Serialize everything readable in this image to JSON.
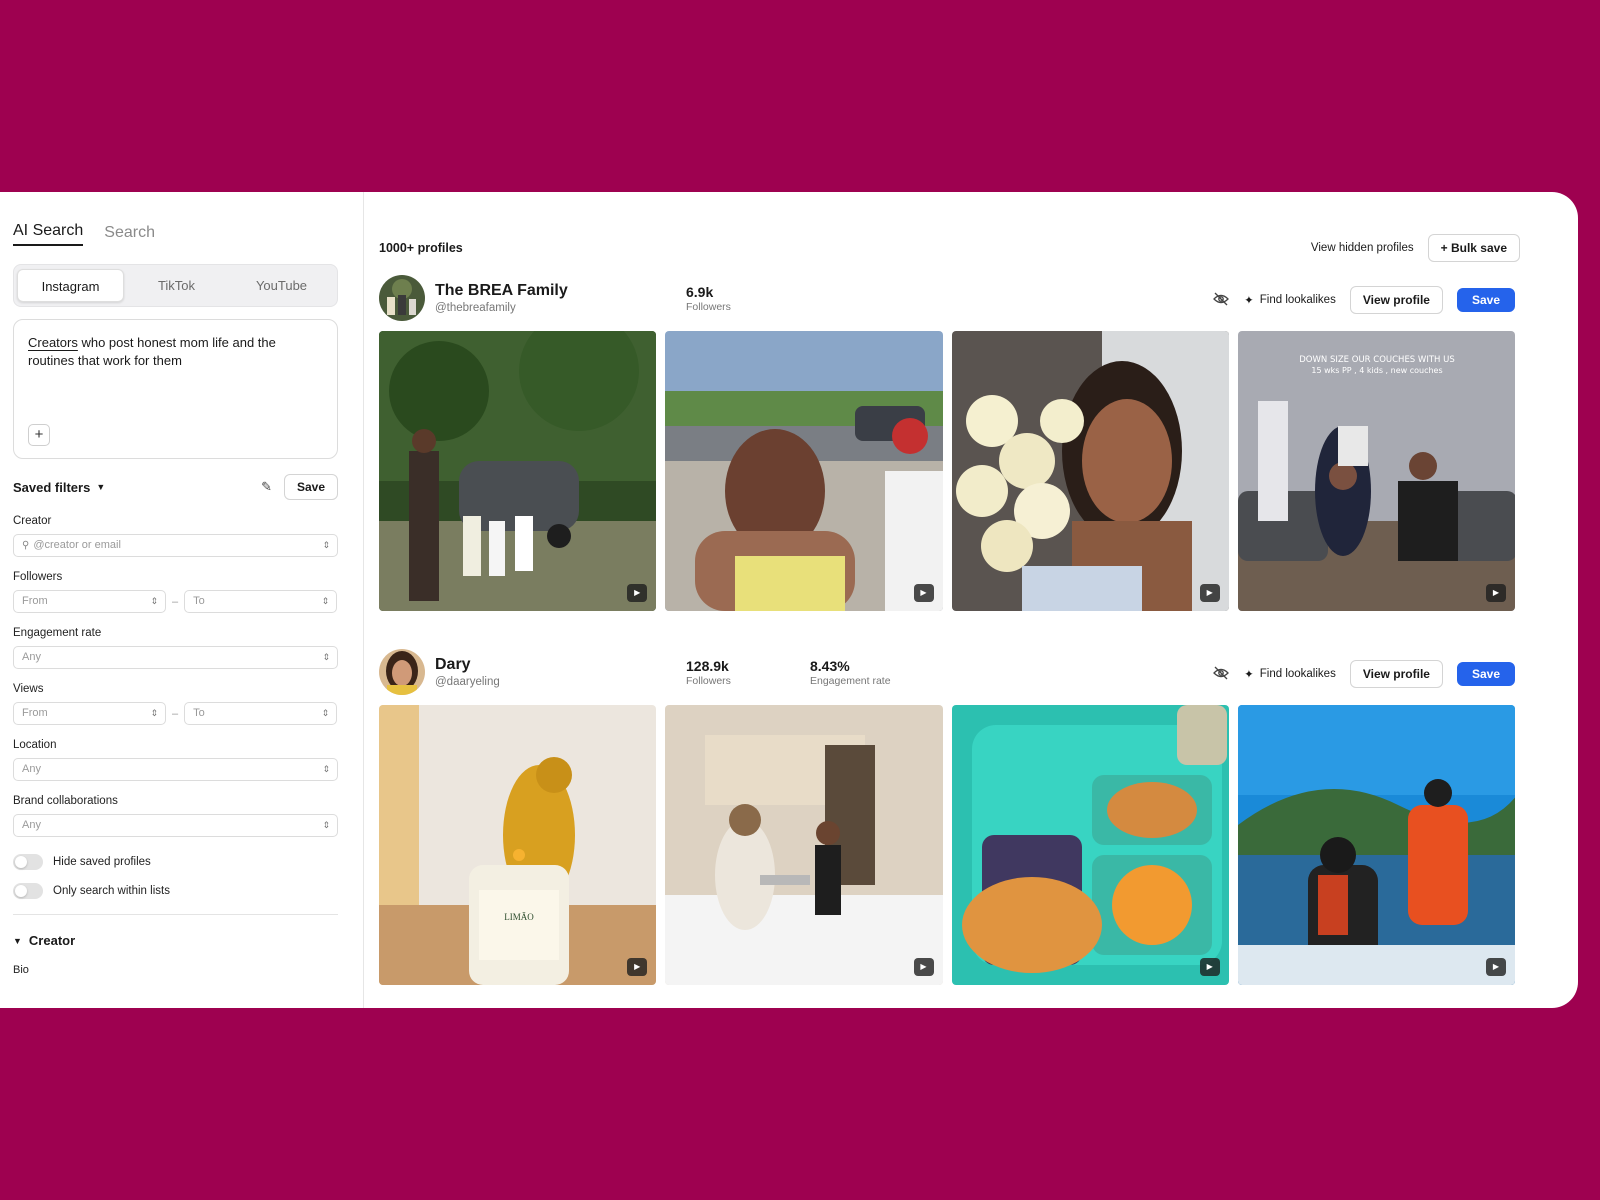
{
  "sidebar": {
    "tabs": [
      {
        "label": "AI Search"
      },
      {
        "label": "Search"
      }
    ],
    "platforms": [
      {
        "label": "Instagram"
      },
      {
        "label": "TikTok"
      },
      {
        "label": "YouTube"
      }
    ],
    "prompt": {
      "underlined_word": "Creators",
      "text": " who post honest mom life and the routines that work for them"
    },
    "saved_filters": {
      "label": "Saved filters",
      "save_label": "Save"
    },
    "creator": {
      "label": "Creator",
      "placeholder": "@creator or email"
    },
    "followers": {
      "label": "Followers",
      "from": "From",
      "to": "To"
    },
    "engagement": {
      "label": "Engagement rate",
      "value": "Any"
    },
    "views": {
      "label": "Views",
      "from": "From",
      "to": "To"
    },
    "location": {
      "label": "Location",
      "value": "Any"
    },
    "brand": {
      "label": "Brand collaborations",
      "value": "Any"
    },
    "toggles": [
      {
        "label": "Hide saved profiles"
      },
      {
        "label": "Only search within lists"
      }
    ],
    "section": {
      "label": "Creator"
    },
    "bio_label": "Bio"
  },
  "main": {
    "count": "1000+ profiles",
    "view_hidden": "View hidden profiles",
    "bulk_save": "+ Bulk save",
    "profiles": [
      {
        "name": "The BREA Family",
        "handle": "@thebreafamily",
        "followers_value": "6.9k",
        "followers_label": "Followers",
        "find_lookalikes": "Find lookalikes",
        "view_profile": "View profile",
        "save": "Save",
        "overlay_text": [
          "DOWN SIZE OUR COUCHES WITH US",
          "15 wks PP , 4 kids , new couches"
        ]
      },
      {
        "name": "Dary",
        "handle": "@daaryeling",
        "followers_value": "128.9k",
        "followers_label": "Followers",
        "engagement_value": "8.43%",
        "engagement_label": "Engagement rate",
        "find_lookalikes": "Find lookalikes",
        "view_profile": "View profile",
        "save": "Save"
      }
    ]
  },
  "colors": {
    "background": "#9e0150",
    "primary": "#2563eb"
  }
}
